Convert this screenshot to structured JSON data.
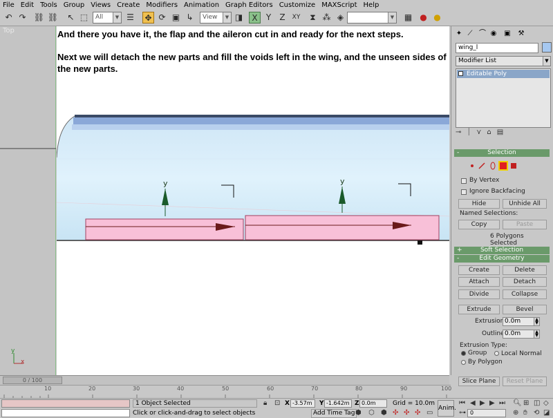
{
  "menu": [
    "File",
    "Edit",
    "Tools",
    "Group",
    "Views",
    "Create",
    "Modifiers",
    "Animation",
    "Graph Editors",
    "Customize",
    "MAXScript",
    "Help"
  ],
  "toolbar": {
    "selection_filter": "All",
    "ref_coord": "View",
    "named_selection": ""
  },
  "viewport": {
    "label": "Top",
    "axis_y": "y",
    "axis_x": "x",
    "gizmo_label": "y"
  },
  "content": {
    "line1": "And there you have it, the flap and the aileron cut in and ready for the next steps.",
    "line2": "Next we will detach the new parts and fill the voids left in the wing, and the unseen sides of the new parts."
  },
  "panel": {
    "object_name": "wing_l",
    "object_color": "#a6c8f0",
    "modifier_list": "Modifier List",
    "stack_item": "Editable Poly",
    "selection": {
      "title": "Selection",
      "by_vertex": "By Vertex",
      "ignore_backfacing": "Ignore Backfacing",
      "hide": "Hide",
      "unhide_all": "Unhide All",
      "named_selections": "Named Selections:",
      "copy": "Copy",
      "paste": "Paste",
      "status": "6 Polygons Selected"
    },
    "soft_selection": "Soft Selection",
    "edit_geometry": {
      "title": "Edit Geometry",
      "create": "Create",
      "delete": "Delete",
      "attach": "Attach",
      "detach": "Detach",
      "divide": "Divide",
      "collapse": "Collapse",
      "extrude": "Extrude",
      "bevel": "Bevel",
      "extrusion_label": "Extrusion:",
      "extrusion_value": "0.0m",
      "outline_label": "Outline",
      "outline_value": "0.0m",
      "extrusion_type": "Extrusion Type:",
      "group": "Group",
      "local_normal": "Local Normal",
      "by_polygon": "By Polygon",
      "slice_plane": "Slice Plane",
      "reset_plane": "Reset Plane"
    }
  },
  "timeline": {
    "slider": "0 / 100",
    "ticks": [
      "10",
      "20",
      "30",
      "40",
      "50",
      "60",
      "70",
      "80",
      "90",
      "100"
    ]
  },
  "status": {
    "selected": "1 Object Selected",
    "prompt": "Click or click-and-drag to select objects",
    "x_label": "X",
    "x_value": "-3.57m",
    "y_label": "Y",
    "y_value": "-1.642m",
    "z_label": "Z",
    "z_value": "0.0m",
    "grid": "Grid = 10.0m",
    "add_time_tag": "Add Time Tag",
    "anim": "Anim.",
    "frame": "0"
  }
}
